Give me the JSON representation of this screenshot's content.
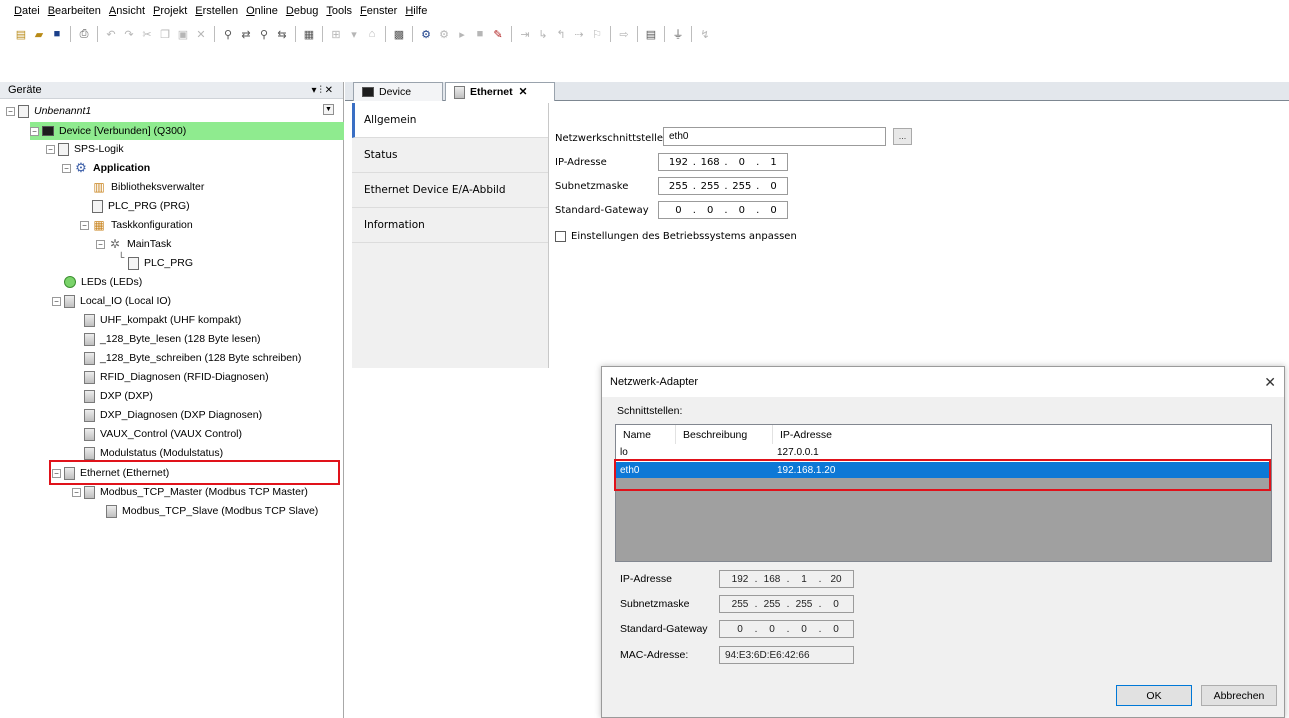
{
  "menu": [
    "Datei",
    "Bearbeiten",
    "Ansicht",
    "Projekt",
    "Erstellen",
    "Online",
    "Debug",
    "Tools",
    "Fenster",
    "Hilfe"
  ],
  "devices_panel": {
    "title": "Geräte",
    "pin": "▾ ⫶ ✕",
    "tree": {
      "project": "Unbenannt1",
      "device": "Device [Verbunden] (Q300)",
      "sps_logik": "SPS-Logik",
      "application": "Application",
      "library_manager": "Bibliotheksverwalter",
      "plc_prg": "PLC_PRG (PRG)",
      "task_config": "Taskkonfiguration",
      "main_task": "MainTask",
      "plc_prg_call": "PLC_PRG",
      "leds": "LEDs (LEDs)",
      "local_io": "Local_IO (Local IO)",
      "io_items": [
        "UHF_kompakt (UHF kompakt)",
        "_128_Byte_lesen (128 Byte lesen)",
        "_128_Byte_schreiben (128 Byte schreiben)",
        "RFID_Diagnosen (RFID-Diagnosen)",
        "DXP (DXP)",
        "DXP_Diagnosen (DXP Diagnosen)",
        "VAUX_Control (VAUX Control)",
        "Modulstatus (Modulstatus)"
      ],
      "ethernet": "Ethernet (Ethernet)",
      "modbus_master": "Modbus_TCP_Master (Modbus TCP Master)",
      "modbus_slave": "Modbus_TCP_Slave (Modbus TCP Slave)"
    }
  },
  "editor": {
    "tabs": [
      "Device",
      "Ethernet"
    ],
    "vertical_tabs": [
      "Allgemein",
      "Status",
      "Ethernet Device E/A-Abbild",
      "Information"
    ],
    "interface_label": "Netzwerkschnittstelle:",
    "interface_value": "eth0",
    "browse_label": "...",
    "ip_label": "IP-Adresse",
    "ip_octets": [
      "192",
      "168",
      "0",
      "1"
    ],
    "subnet_label": "Subnetzmaske",
    "subnet_octets": [
      "255",
      "255",
      "255",
      "0"
    ],
    "gateway_label": "Standard-Gateway",
    "gateway_octets": [
      "0",
      "0",
      "0",
      "0"
    ],
    "os_settings_label": "Einstellungen des Betriebssystems anpassen"
  },
  "dialog": {
    "title": "Netzwerk-Adapter",
    "close": "✕",
    "interfaces_label": "Schnittstellen:",
    "columns": [
      "Name",
      "Beschreibung",
      "IP-Adresse"
    ],
    "rows": [
      {
        "name": "lo",
        "desc": "",
        "ip": "127.0.0.1"
      },
      {
        "name": "eth0",
        "desc": "",
        "ip": "192.168.1.20"
      }
    ],
    "ip_label": "IP-Adresse",
    "ip_octets": [
      "192",
      "168",
      "1",
      "20"
    ],
    "subnet_label": "Subnetzmaske",
    "subnet_octets": [
      "255",
      "255",
      "255",
      "0"
    ],
    "gateway_label": "Standard-Gateway",
    "gateway_octets": [
      "0",
      "0",
      "0",
      "0"
    ],
    "mac_label": "MAC-Adresse:",
    "mac_value": "94:E3:6D:E6:42:66",
    "ok": "OK",
    "cancel": "Abbrechen"
  },
  "colors": {
    "selected_row": "#0d78d6",
    "device_highlight": "#8feb8f",
    "annotation_box": "#e0121a"
  }
}
